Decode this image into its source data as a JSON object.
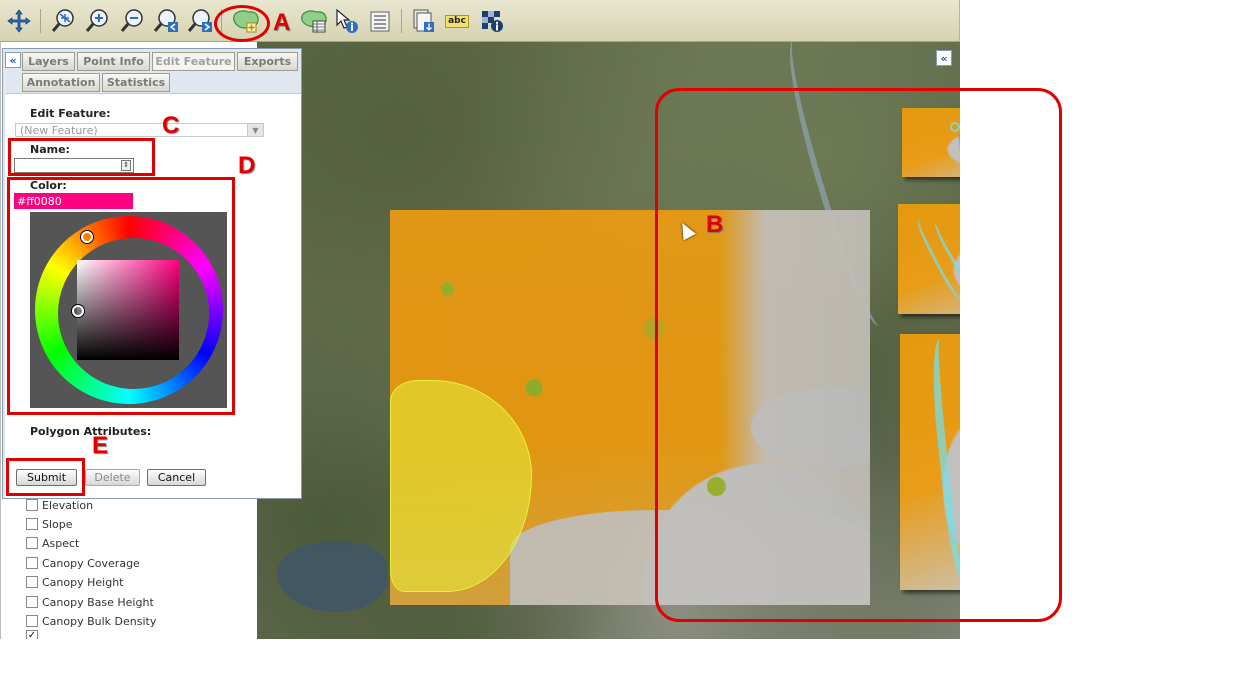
{
  "toolbar": {
    "tools": [
      {
        "name": "pan-tool",
        "icon": "pan-icon"
      },
      {
        "name": "zoom-full-extent-tool",
        "icon": "zoom-extent-icon"
      },
      {
        "name": "zoom-in-tool",
        "icon": "zoom-in-icon"
      },
      {
        "name": "zoom-out-tool",
        "icon": "zoom-out-icon"
      },
      {
        "name": "zoom-previous-tool",
        "icon": "zoom-previous-icon"
      },
      {
        "name": "zoom-next-tool",
        "icon": "zoom-next-icon"
      },
      {
        "name": "draw-polygon-tool",
        "icon": "polygon-draw-icon"
      },
      {
        "name": "polygon-table-tool",
        "icon": "polygon-table-icon"
      },
      {
        "name": "identify-tool",
        "icon": "identify-arrow-icon"
      },
      {
        "name": "list-tool",
        "icon": "list-icon"
      },
      {
        "name": "export-tool",
        "icon": "export-layer-icon"
      },
      {
        "name": "label-tool",
        "icon": "abc-label-icon"
      },
      {
        "name": "map-info-tool",
        "icon": "map-info-icon"
      }
    ],
    "label_tool_text": "abc"
  },
  "panel": {
    "collapse_glyph": "«",
    "tabs": [
      {
        "label": "Layers",
        "active": false
      },
      {
        "label": "Point Info",
        "active": false
      },
      {
        "label": "Edit Feature",
        "active": true
      },
      {
        "label": "Exports",
        "active": false
      },
      {
        "label": "Annotation",
        "active": false
      },
      {
        "label": "Statistics",
        "active": false
      }
    ],
    "edit_feature_label": "Edit Feature:",
    "feature_select_value": "(New Feature)",
    "name_label": "Name:",
    "name_value": "",
    "color_label": "Color:",
    "color_value": "#ff0080",
    "polygon_attributes_label": "Polygon Attributes:",
    "buttons": {
      "submit": "Submit",
      "delete": "Delete",
      "cancel": "Cancel"
    }
  },
  "layers": [
    {
      "label": "Elevation",
      "checked": false
    },
    {
      "label": "Slope",
      "checked": false
    },
    {
      "label": "Aspect",
      "checked": false
    },
    {
      "label": "Canopy Coverage",
      "checked": false
    },
    {
      "label": "Canopy Height",
      "checked": false
    },
    {
      "label": "Canopy Base Height",
      "checked": false
    },
    {
      "label": "Canopy Bulk Density",
      "checked": false
    },
    {
      "label": "",
      "checked": true
    }
  ],
  "map": {
    "collapse_glyph": "«"
  },
  "annotations": {
    "A": "A",
    "B": "B",
    "C": "C",
    "D": "D",
    "E": "E"
  },
  "colors": {
    "annotation_red": "#e10000",
    "selected_color": "#ff0080",
    "raster_orange": "#e8990f",
    "polygon_yellow": "#e6f23c"
  }
}
